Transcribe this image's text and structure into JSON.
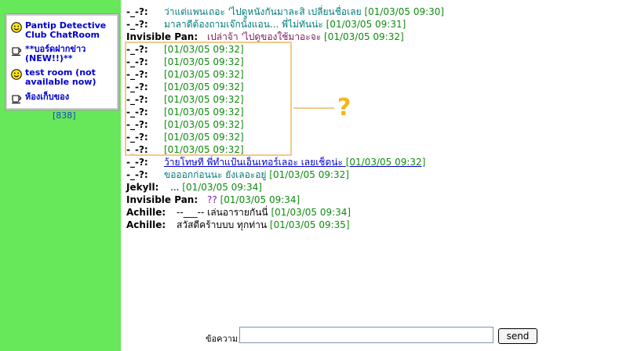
{
  "sidebar": {
    "rooms": [
      {
        "icon": "smiley-icon",
        "label": "Pantip Detective Club ChatRoom"
      },
      {
        "icon": "coffee-cup-icon",
        "label": "**บอร์ดฝากข่าว (NEW!!)**"
      },
      {
        "icon": "smiley-icon",
        "label": "test room (not available now)"
      },
      {
        "icon": "coffee-cup-icon",
        "label": "ห้องเก็บของ"
      }
    ],
    "count": "[838]"
  },
  "messages": [
    {
      "sender": "-_-?:",
      "text": "ว่าแต่แพนเถอะ 'ไปดูหนังกันมาละสิ เปลี่ยนชื่อเลย",
      "time": "[01/03/05 09:30]"
    },
    {
      "sender": "-_-?:",
      "text": "มาลาดีต้องถามเจ๊กนั้งแอน... พี่ไม่ทันน่ะ",
      "time": "[01/03/05 09:31]"
    },
    {
      "sender": "Invisible Pan:",
      "text": "เปล่าจ้า 'ไปดูของใช้มาอะจะ",
      "time": "[01/03/05 09:32]"
    },
    {
      "sender": "-_-?:",
      "text": "",
      "time": "[01/03/05 09:32]"
    },
    {
      "sender": "-_-?:",
      "text": "",
      "time": "[01/03/05 09:32]"
    },
    {
      "sender": "-_-?:",
      "text": "",
      "time": "[01/03/05 09:32]"
    },
    {
      "sender": "-_-?:",
      "text": "",
      "time": "[01/03/05 09:32]"
    },
    {
      "sender": "-_-?:",
      "text": "",
      "time": "[01/03/05 09:32]"
    },
    {
      "sender": "-_-?:",
      "text": "",
      "time": "[01/03/05 09:32]"
    },
    {
      "sender": "-_-?:",
      "text": "",
      "time": "[01/03/05 09:32]"
    },
    {
      "sender": "-_-?:",
      "text": "",
      "time": "[01/03/05 09:32]"
    },
    {
      "sender": "-_-?:",
      "text": "",
      "time": "[01/03/05 09:32]"
    },
    {
      "sender": "-_-?:",
      "text": "ว้ายโทษที พี่ทำแป้นเอ็นเทอร์เลอะ เลยเช็ดน่ะ",
      "time": "[01/03/05 09:32]"
    },
    {
      "sender": "-_-?:",
      "text": "ขอออกก่อนนะ ยังเลอะอยู่",
      "time": "[01/03/05 09:32]"
    },
    {
      "sender": "Jekyll:",
      "text": "...",
      "time": "[01/03/05 09:34]"
    },
    {
      "sender": "Invisible Pan:",
      "text": "??",
      "time": "[01/03/05 09:34]"
    },
    {
      "sender": "Achille:",
      "text": "--___-- เล่นอารายกันนี่",
      "time": "[01/03/05 09:34]"
    },
    {
      "sender": "Achille:",
      "text": "สวัสดีคร้าบบบ ทุกท่าน",
      "time": "[01/03/05 09:35]"
    }
  ],
  "annotation": {
    "mark": "?",
    "color": "#f5b51a",
    "box_color": "#f3c98b"
  },
  "composer": {
    "label": "ข้อความ",
    "input_value": "",
    "send_label": "send"
  },
  "colors": {
    "sidebar_bg": "#66e85a",
    "timestamp": "#118a11",
    "link": "#0000cc"
  }
}
